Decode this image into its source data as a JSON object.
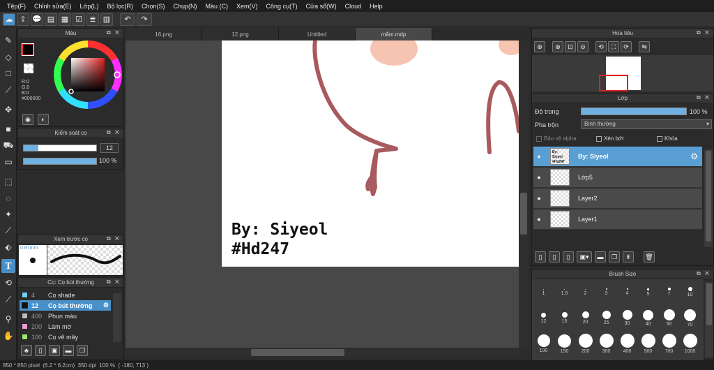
{
  "menu": [
    "Tệp(F)",
    "Chỉnh sửa(E)",
    "Lớp(L)",
    "Bộ lọc(R)",
    "Chọn(S)",
    "Chụp(N)",
    "Màu (C)",
    "Xem(V)",
    "Công cụ(T)",
    "Cửa sổ(W)",
    "Cloud",
    "Help"
  ],
  "tabs": [
    "16.png",
    "12.png",
    "Untitled",
    "mắm.mdp"
  ],
  "color_panel": {
    "title": "Màu",
    "r": "R:0",
    "g": "G:0",
    "b": "B:0",
    "hex": "#000000"
  },
  "brush_control": {
    "title": "Kiểm soát cọ",
    "size": "12",
    "opacity": "100 %",
    "size_fill": 0.2,
    "opacity_fill": 1.0
  },
  "brush_preview": {
    "title": "Xem trước cọ",
    "size": "0.87mm"
  },
  "brush_list": {
    "title": "Cọ: Cọ bút thường",
    "items": [
      {
        "num": "4",
        "name": "Cọ shade",
        "color": "#6ed3f0"
      },
      {
        "num": "12",
        "name": "Cọ bút thường",
        "color": "#111111",
        "selected": true
      },
      {
        "num": "400",
        "name": "Phun màu",
        "color": "#bdbdbd"
      },
      {
        "num": "200",
        "name": "Làm mờ",
        "color": "#f29ad8"
      },
      {
        "num": "100",
        "name": "Cọ vẽ mây",
        "color": "#9be86c"
      }
    ]
  },
  "canvas_text": {
    "line1": "By: Siyeol",
    "line2": "#Hd247"
  },
  "navigator": {
    "title": "Hoa tiêu"
  },
  "layers": {
    "title": "Lớp",
    "opacity_label": "Độ trong",
    "opacity": "100 %",
    "blend_label": "Pha trộn",
    "blend": "Bình thường",
    "protect_alpha": "Bảo vệ alpha",
    "clip": "Xén bớt",
    "lock": "Khóa",
    "items": [
      {
        "name": "By: Siyeol",
        "thumb": "By: Siyeol #Hd247",
        "selected": true
      },
      {
        "name": "Lớp5"
      },
      {
        "name": "Layer2"
      },
      {
        "name": "Layer1"
      }
    ]
  },
  "brush_size": {
    "title": "Brush Size",
    "sizes": [
      "1",
      "1.5",
      "2",
      "3",
      "4",
      "5",
      "7",
      "10",
      "12",
      "15",
      "20",
      "25",
      "30",
      "40",
      "50",
      "70",
      "100",
      "150",
      "200",
      "300",
      "400",
      "500",
      "700",
      "1000"
    ]
  },
  "status": "850 * 850 pixel  (6.2 * 6.2cm)  350 dpi  100 %  ( -180, 713 )",
  "colors": {
    "accent": "#4a90c8",
    "stroke": "#a85a5e",
    "peach": "#f7c4b2"
  }
}
